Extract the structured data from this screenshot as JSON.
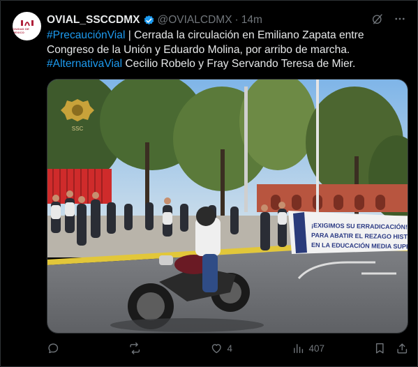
{
  "tweet": {
    "author_name": "OVIAL_SSCCDMX",
    "handle": "@OVIALCDMX",
    "separator": "·",
    "time": "14m",
    "avatar_text": "CIUDAD DE MEXICO",
    "text_parts": [
      {
        "type": "hashtag",
        "text": "#PrecauciónVial"
      },
      {
        "type": "text",
        "text": " | Cerrada la circulación en Emiliano Zapata entre Congreso de la Unión y Eduardo Molina, por arribo de marcha. "
      },
      {
        "type": "hashtag",
        "text": "#AlternativaVial"
      },
      {
        "type": "text",
        "text": " Cecilio Robelo y Fray Servando Teresa de Mier."
      }
    ]
  },
  "media": {
    "badge_text": "SSC",
    "banner_lines": [
      "¡EXIGIMOS SU ERRADICACIÓN!",
      "PARA ABATIR EL REZAGO HISTÓRICO",
      "EN LA EDUCACIÓN MEDIA SUPERIOR"
    ]
  },
  "actions": {
    "replies": "",
    "reposts": "",
    "likes": "4",
    "views": "407"
  },
  "colors": {
    "accent": "#1d9bf0",
    "muted": "#71767b",
    "text": "#e7e9ea",
    "background": "#000000"
  },
  "icons": [
    "verified-badge-icon",
    "grok-icon",
    "more-icon",
    "reply-icon",
    "repost-icon",
    "like-icon",
    "views-icon",
    "bookmark-icon",
    "share-icon"
  ]
}
